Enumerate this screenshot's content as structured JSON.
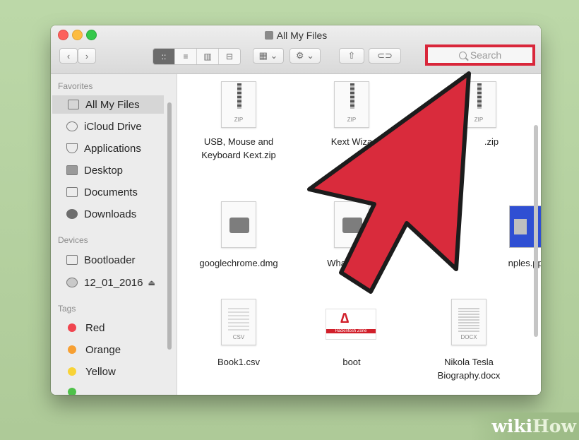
{
  "window": {
    "title": "All My Files"
  },
  "toolbar": {
    "back_glyph": "‹",
    "forward_glyph": "›",
    "view_modes": [
      "::",
      "≡",
      "▥",
      "⊟"
    ],
    "arrange_glyph": "▦ ⌄",
    "action_glyph": "⚙ ⌄",
    "share_glyph": "⇧",
    "tags_glyph": "⊂⊃",
    "search_placeholder": "Search"
  },
  "sidebar": {
    "favorites_label": "Favorites",
    "favorites": [
      {
        "label": "All My Files",
        "icon": "all-files-icon",
        "selected": true
      },
      {
        "label": "iCloud Drive",
        "icon": "cloud-icon"
      },
      {
        "label": "Applications",
        "icon": "applications-icon"
      },
      {
        "label": "Desktop",
        "icon": "desktop-icon"
      },
      {
        "label": "Documents",
        "icon": "documents-icon"
      },
      {
        "label": "Downloads",
        "icon": "downloads-icon"
      }
    ],
    "devices_label": "Devices",
    "devices": [
      {
        "label": "Bootloader",
        "icon": "disk-icon"
      },
      {
        "label": "12_01_2016",
        "icon": "disc-icon",
        "eject": "⏏"
      }
    ],
    "tags_label": "Tags",
    "tags": [
      {
        "label": "Red",
        "color": "#f0454f"
      },
      {
        "label": "Orange",
        "color": "#f7a033"
      },
      {
        "label": "Yellow",
        "color": "#f8d337"
      }
    ]
  },
  "files": [
    {
      "line1": "USB, Mouse and",
      "line2": "Keyboard Kext.zip",
      "ext": "ZIP"
    },
    {
      "line1": "Kext Wiza",
      "line2": "",
      "ext": "ZIP"
    },
    {
      "line1": ".zip",
      "line2": "",
      "ext": "ZIP"
    },
    {
      "line1": "googlechrome.dmg",
      "line2": ""
    },
    {
      "line1": "WhatsA",
      "line2": ""
    },
    {
      "line1": "nples.ppt",
      "line2": ""
    },
    {
      "line1": "Book1.csv",
      "line2": "",
      "ext": "CSV"
    },
    {
      "line1": "boot",
      "line2": "",
      "thumb_text": "Hackintosh Zone"
    },
    {
      "line1": "Nikola Tesla",
      "line2": "Biography.docx",
      "ext": "DOCX"
    },
    {
      "line1": "",
      "line2": "",
      "thumb_text": "wiki"
    }
  ],
  "watermark": {
    "brand_a": "wiki",
    "brand_b": "How"
  },
  "colors": {
    "highlight_red": "#d9263a",
    "selection": "#d6d6d6"
  }
}
